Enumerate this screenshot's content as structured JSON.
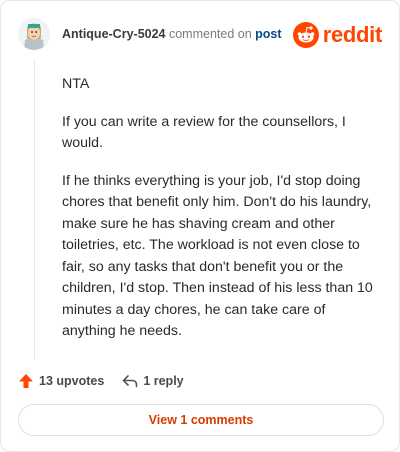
{
  "header": {
    "username": "Antique-Cry-5024",
    "commented_text": "commented on",
    "post_link": "post",
    "brand": "reddit",
    "brand_color": "#ff4500"
  },
  "comment": {
    "paragraphs": [
      "NTA",
      "If you can write a review for the counsellors, I would.",
      "If he thinks everything is your job, I'd stop doing chores that benefit only him. Don't do his laundry, make sure he has shaving cream and other toiletries, etc. The workload is not even close to fair, so any tasks that don't benefit you or the children, I'd stop. Then instead of his less than 10 minutes a day chores, he can take care of anything he needs."
    ]
  },
  "actions": {
    "upvotes": "13 upvotes",
    "upvote_icon": "upvote-arrow-icon",
    "replies": "1 reply",
    "reply_icon": "reply-arrow-icon"
  },
  "footer": {
    "view_comments": "View 1 comments",
    "accent": "#d93a00"
  }
}
